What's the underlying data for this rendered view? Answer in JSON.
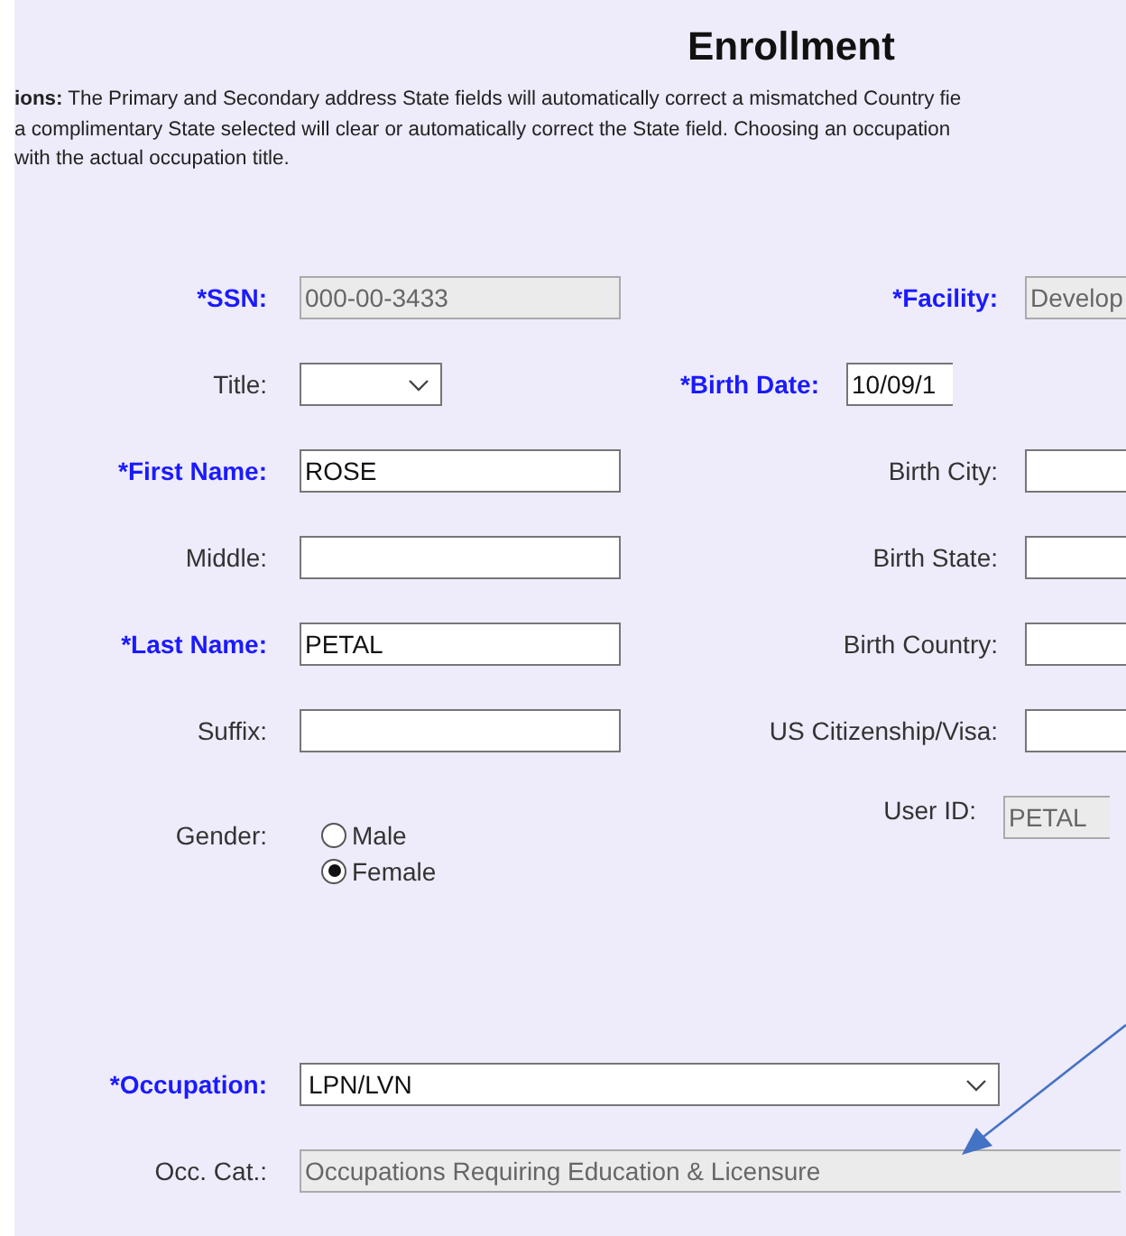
{
  "title": "Enrollment",
  "instructions": [
    "**ions:** The Primary and Secondary address State fields will automatically correct a mismatched Country fie",
    "a complimentary State selected will clear or automatically correct the State field. Choosing an occupation",
    "with the actual occupation title."
  ],
  "rows": [
    {
      "left": {
        "label": "*SSN:",
        "required": true,
        "kind": "text",
        "value": "000-00-3433",
        "disabled": true
      },
      "right": {
        "label": "*Facility:",
        "required": true,
        "kind": "text",
        "value": "Develop",
        "disabled": true
      }
    },
    {
      "left": {
        "label": "Title:",
        "required": false,
        "kind": "select"
      },
      "right": {
        "label": "*Birth Date:",
        "required": true,
        "kind": "text",
        "value": "10/09/1",
        "disabled": false
      }
    },
    {
      "left": {
        "label": "*First Name:",
        "required": true,
        "kind": "text",
        "value": "ROSE",
        "disabled": false
      },
      "right": {
        "label": "Birth City:",
        "required": false,
        "kind": "text",
        "disabled": false
      }
    },
    {
      "left": {
        "label": "Middle:",
        "required": false,
        "kind": "text",
        "disabled": false
      },
      "right": {
        "label": "Birth State:",
        "required": false,
        "kind": "text",
        "disabled": false
      }
    },
    {
      "left": {
        "label": "*Last Name:",
        "required": true,
        "kind": "text",
        "value": "PETAL",
        "disabled": false
      },
      "right": {
        "label": "Birth Country:",
        "required": false,
        "kind": "text",
        "disabled": false
      }
    },
    {
      "left": {
        "label": "Suffix:",
        "required": false,
        "kind": "text",
        "disabled": false
      },
      "right": {
        "label": "US Citizenship/Visa:",
        "required": false,
        "kind": "text",
        "disabled": false
      }
    }
  ],
  "user_id": {
    "label": "User ID:",
    "value": "PETAL",
    "disabled": true
  },
  "gender": {
    "label": "Gender:",
    "options": [
      {
        "label": "Male",
        "selected": false
      },
      {
        "label": "Female",
        "selected": true
      }
    ]
  },
  "occupation": {
    "label": "*Occupation:",
    "required": true,
    "value": "LPN/LVN"
  },
  "occ_cat": {
    "label": "Occ. Cat.:",
    "required": false,
    "value": "Occupations Requiring Education & Licensure",
    "disabled": true
  }
}
